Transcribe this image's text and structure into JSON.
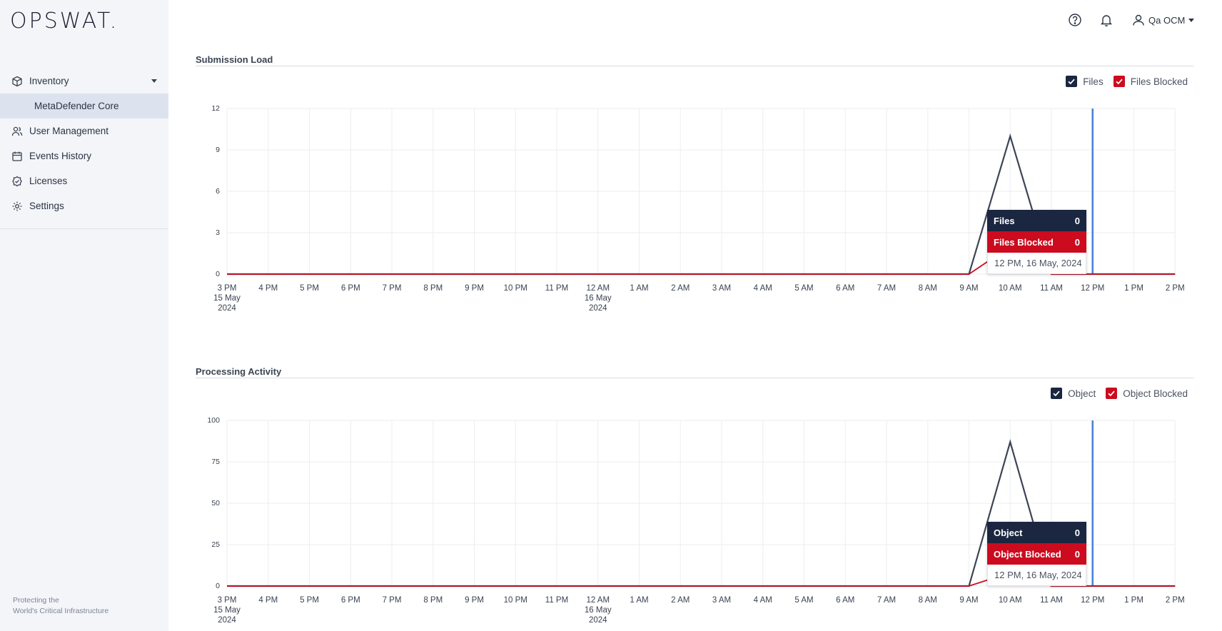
{
  "brand": {
    "logo_text": "OPSWAT.",
    "tagline_line1": "Protecting the",
    "tagline_line2": "World's Critical Infrastructure"
  },
  "sidebar": {
    "items": [
      {
        "label": "Inventory",
        "icon": "cube-icon"
      },
      {
        "label": "MetaDefender Core"
      },
      {
        "label": "User Management",
        "icon": "users-icon"
      },
      {
        "label": "Events History",
        "icon": "calendar-icon"
      },
      {
        "label": "Licenses",
        "icon": "badge-check-icon"
      },
      {
        "label": "Settings",
        "icon": "gear-icon"
      }
    ]
  },
  "header": {
    "user_name": "Qa OCM",
    "icons": [
      "help-icon",
      "bell-icon",
      "user-icon"
    ]
  },
  "colors": {
    "navy": "#1b2640",
    "red": "#cc0b1f",
    "highlight": "#4a7fd4",
    "series_line": "#3d4454"
  },
  "submission": {
    "title": "Submission Load",
    "legend": {
      "files": "Files",
      "blocked": "Files Blocked"
    },
    "tooltip": {
      "files_label": "Files",
      "files_value": "0",
      "blocked_label": "Files Blocked",
      "blocked_value": "0",
      "date": "12 PM, 16 May, 2024"
    },
    "yticks": [
      "12",
      "9",
      "6",
      "3",
      "0"
    ]
  },
  "processing": {
    "title": "Processing Activity",
    "legend": {
      "files": "Object",
      "blocked": "Object Blocked"
    },
    "tooltip": {
      "files_label": "Object",
      "files_value": "0",
      "blocked_label": "Object Blocked",
      "blocked_value": "0",
      "date": "12 PM, 16 May, 2024"
    },
    "yticks": [
      "100",
      "75",
      "50",
      "25",
      "0"
    ]
  },
  "chart_data": [
    {
      "type": "line",
      "categories": [
        "3 PM",
        "4 PM",
        "5 PM",
        "6 PM",
        "7 PM",
        "8 PM",
        "9 PM",
        "10 PM",
        "11 PM",
        "12 AM",
        "1 AM",
        "2 AM",
        "3 AM",
        "4 AM",
        "5 AM",
        "6 AM",
        "7 AM",
        "8 AM",
        "9 AM",
        "10 AM",
        "11 AM",
        "12 PM",
        "1 PM",
        "2 PM"
      ],
      "x_sublabels": {
        "3 PM": [
          "15 May",
          "2024"
        ],
        "12 AM": [
          "16 May",
          "2024"
        ]
      },
      "series": [
        {
          "name": "Files",
          "values": [
            0,
            0,
            0,
            0,
            0,
            0,
            0,
            0,
            0,
            0,
            0,
            0,
            0,
            0,
            0,
            0,
            0,
            0,
            0,
            10,
            0,
            0,
            0,
            0
          ]
        },
        {
          "name": "Files Blocked",
          "values": [
            0,
            0,
            0,
            0,
            0,
            0,
            0,
            0,
            0,
            0,
            0,
            0,
            0,
            0,
            0,
            0,
            0,
            0,
            0,
            2,
            0,
            0,
            0,
            0
          ]
        }
      ],
      "ylim": [
        0,
        12
      ],
      "title": "Submission Load",
      "highlight_category": "12 PM"
    },
    {
      "type": "line",
      "categories": [
        "3 PM",
        "4 PM",
        "5 PM",
        "6 PM",
        "7 PM",
        "8 PM",
        "9 PM",
        "10 PM",
        "11 PM",
        "12 AM",
        "1 AM",
        "2 AM",
        "3 AM",
        "4 AM",
        "5 AM",
        "6 AM",
        "7 AM",
        "8 AM",
        "9 AM",
        "10 AM",
        "11 AM",
        "12 PM",
        "1 PM",
        "2 PM"
      ],
      "x_sublabels": {
        "3 PM": [
          "15 May",
          "2024"
        ],
        "12 AM": [
          "16 May",
          "2024"
        ]
      },
      "series": [
        {
          "name": "Object",
          "values": [
            0,
            0,
            0,
            0,
            0,
            0,
            0,
            0,
            0,
            0,
            0,
            0,
            0,
            0,
            0,
            0,
            0,
            0,
            0,
            87,
            0,
            0,
            0,
            0
          ]
        },
        {
          "name": "Object Blocked",
          "values": [
            0,
            0,
            0,
            0,
            0,
            0,
            0,
            0,
            0,
            0,
            0,
            0,
            0,
            0,
            0,
            0,
            0,
            0,
            0,
            8,
            0,
            0,
            0,
            0
          ]
        }
      ],
      "ylim": [
        0,
        100
      ],
      "title": "Processing Activity",
      "highlight_category": "12 PM"
    }
  ]
}
